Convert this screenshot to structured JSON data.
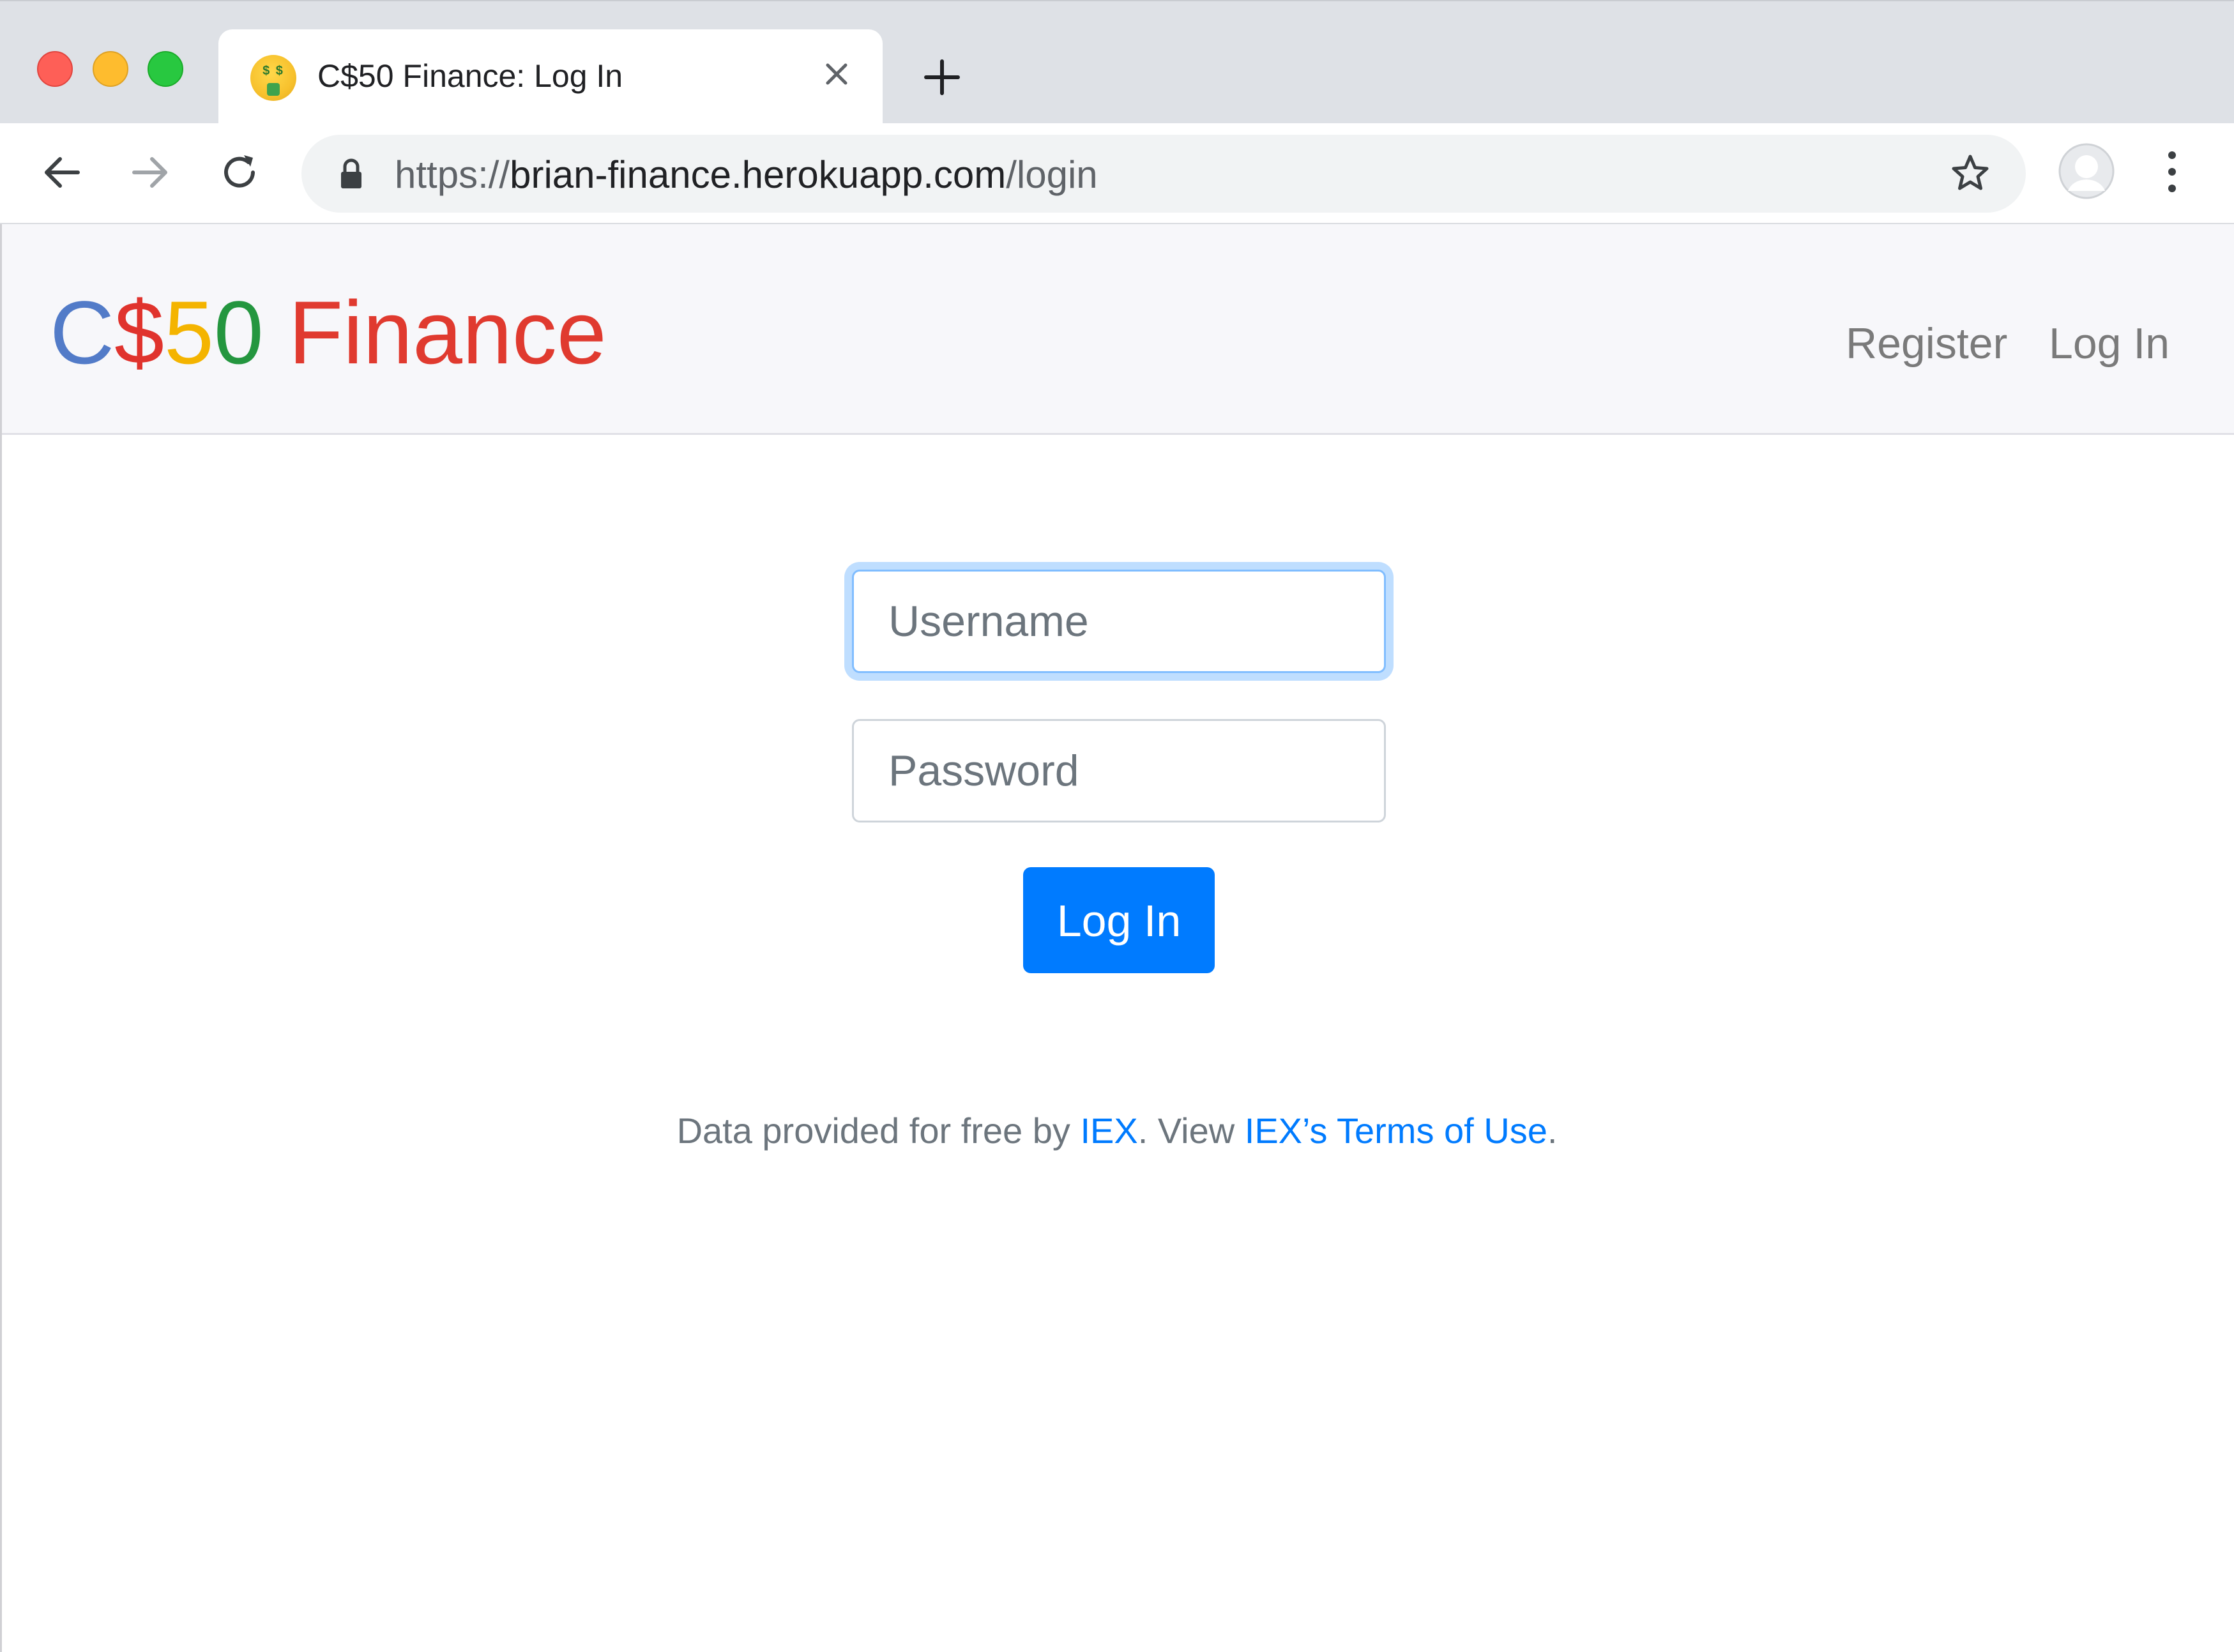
{
  "browser": {
    "tab_title": "C$50 Finance: Log In",
    "tab_favicon_eyes": "$ $",
    "url_scheme": "https://",
    "url_host": "brian-finance.herokuapp.com",
    "url_path": "/login"
  },
  "navbar": {
    "brand": {
      "c": "C",
      "dollar": "$",
      "five": "5",
      "zero": "0",
      "finance": "Finance"
    },
    "links": {
      "register": "Register",
      "login": "Log In"
    }
  },
  "form": {
    "username_placeholder": "Username",
    "password_placeholder": "Password",
    "submit_label": "Log In"
  },
  "footer": {
    "text_before": "Data provided for free by ",
    "iex_link": "IEX",
    "text_middle": ". View ",
    "terms_link": "IEX’s Terms of Use",
    "text_after": "."
  },
  "colors": {
    "brand_blue": "#527bc8",
    "brand_red": "#e0332d",
    "brand_yellow": "#f4b400",
    "brand_green": "#24963f",
    "primary": "#007bff"
  }
}
